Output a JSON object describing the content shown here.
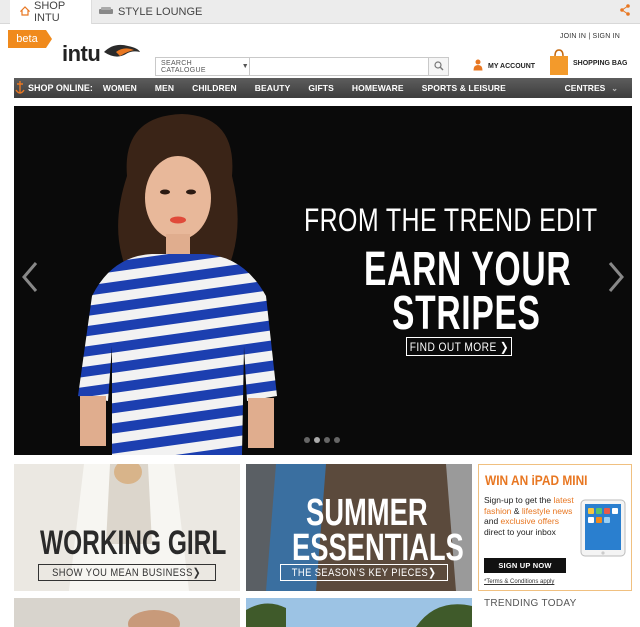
{
  "tabs": [
    {
      "label": "SHOP INTU",
      "icon": "home-icon"
    },
    {
      "label": "STYLE LOUNGE",
      "icon": "sofa-icon"
    }
  ],
  "header": {
    "beta": "beta",
    "logo": "intu",
    "search": {
      "category": "SEARCH CATALOGUE",
      "placeholder": ""
    },
    "join": "JOIN IN",
    "sep": "|",
    "signin": "SIGN IN",
    "account": "MY ACCOUNT",
    "bag": "SHOPPING BAG"
  },
  "nav": {
    "title": "SHOP ONLINE:",
    "items": [
      "WOMEN",
      "MEN",
      "CHILDREN",
      "BEAUTY",
      "GIFTS",
      "HOMEWARE",
      "SPORTS & LEISURE"
    ],
    "centres": "CENTRES"
  },
  "hero": {
    "kicker": "FROM THE TREND EDIT",
    "title1": "EARN YOUR",
    "title2": "STRIPES",
    "cta": "FIND OUT MORE ❯",
    "slides": 4,
    "active_slide": 2
  },
  "tiles": [
    {
      "headline": "WORKING GIRL",
      "sub": "SHOW YOU MEAN BUSINESS❯"
    },
    {
      "headline1": "SUMMER",
      "headline2": "ESSENTIALS",
      "sub": "THE SEASON’S KEY PIECES❯"
    }
  ],
  "promo": {
    "title": "WIN AN iPAD MINI",
    "t1": "Sign-up to get the ",
    "h1": "latest fashion",
    "t2": " & ",
    "h2": "lifestyle news",
    "t3": " and ",
    "h3": "exclusive offers",
    "t4": " direct to your inbox",
    "button": "SIGN UP NOW",
    "terms": "*Terms & Conditions apply"
  },
  "trending": "TRENDING TODAY",
  "colors": {
    "accent": "#e87722",
    "nav": "#4a4a4a",
    "hero_bg": "#0a0a0a"
  }
}
